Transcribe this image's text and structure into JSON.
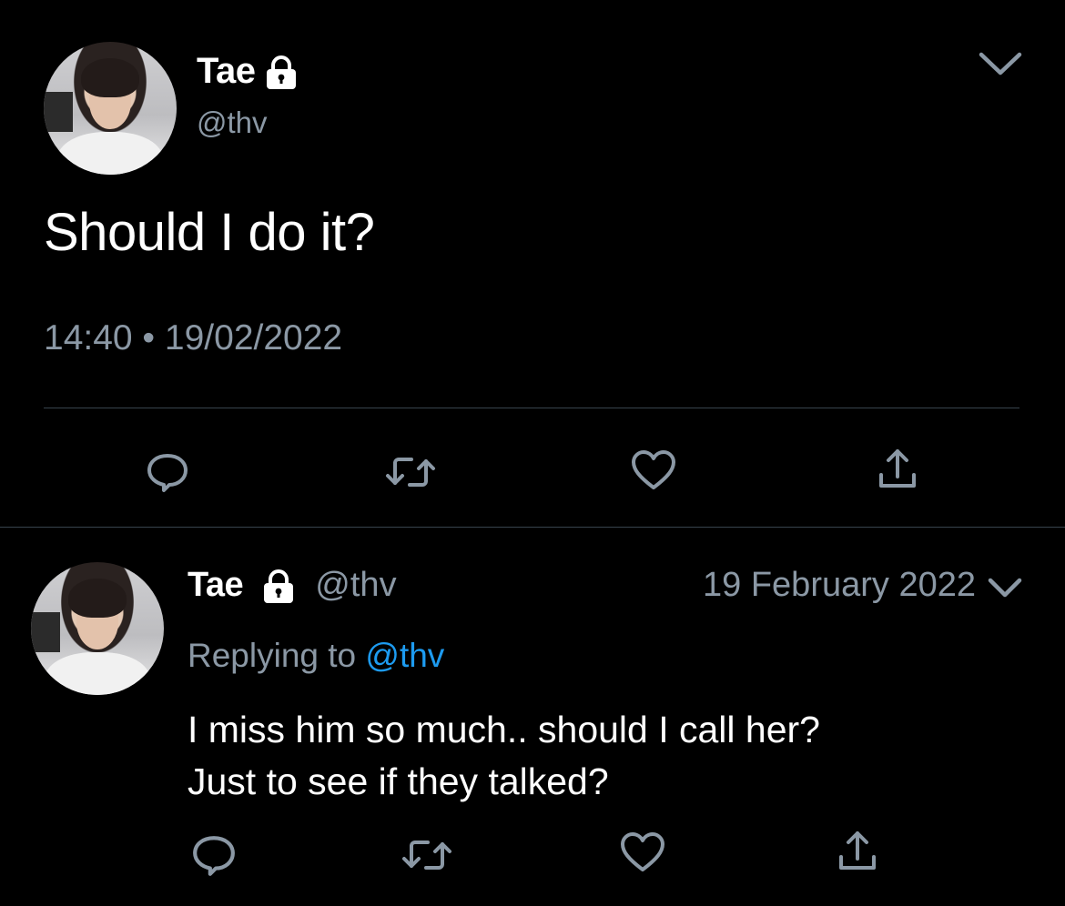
{
  "tweet": {
    "display_name": "Tae",
    "handle": "@thv",
    "text": "Should I do it?",
    "timestamp": "14:40 • 19/02/2022"
  },
  "reply": {
    "display_name": "Tae",
    "handle": "@thv",
    "date": "19 February 2022",
    "replying_prefix": "Replying to",
    "replying_mention": "@thv",
    "text_line1": "I miss him so much.. should I call her?",
    "text_line2": "Just to see if they talked?"
  },
  "icons": {
    "lock": "lock-icon",
    "caret": "chevron-down-icon",
    "reply": "reply-icon",
    "retweet": "retweet-icon",
    "like": "heart-icon",
    "share": "share-icon"
  },
  "colors": {
    "background": "#000000",
    "text": "#ffffff",
    "secondary": "#8b98a5",
    "mention": "#1d9bf0",
    "divider": "#38444d"
  }
}
